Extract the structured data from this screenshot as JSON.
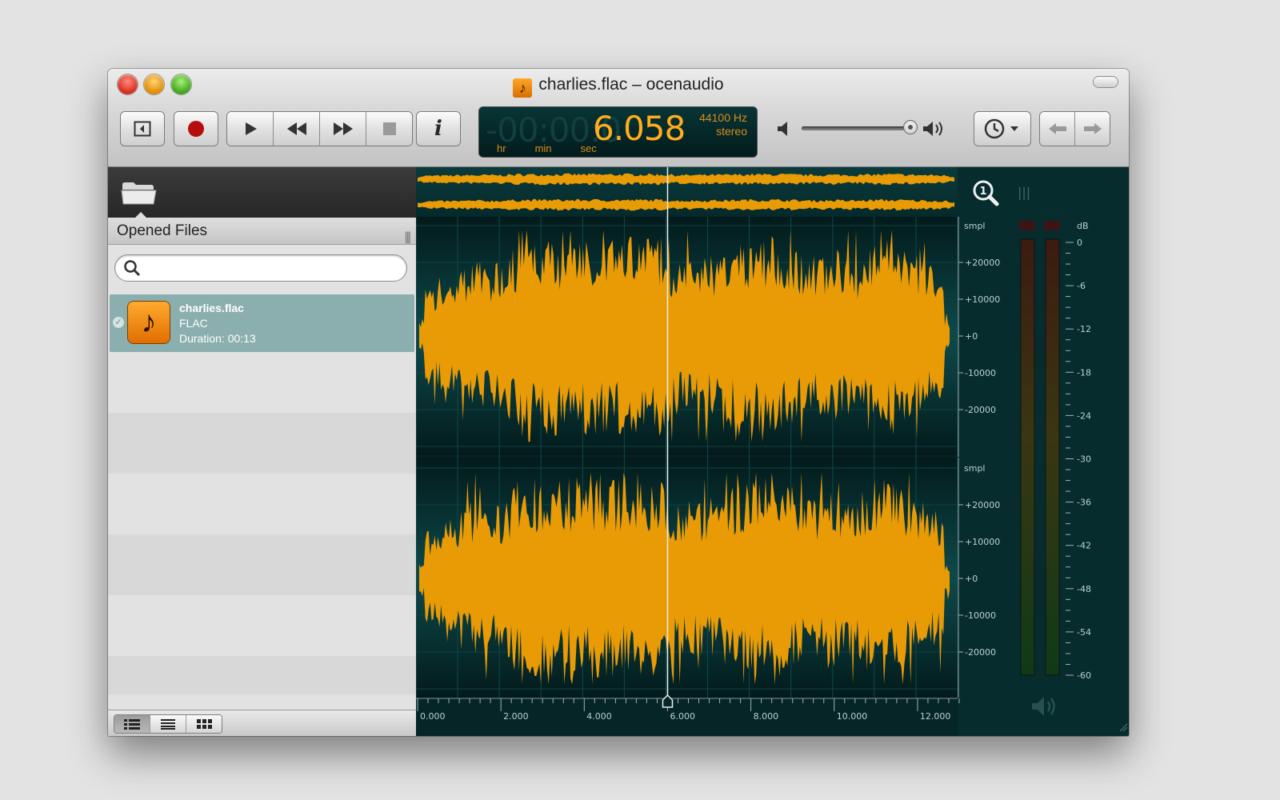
{
  "window": {
    "title": "charlies.flac – ocenaudio"
  },
  "transport": {
    "time_dim": "-00:00:0",
    "time_value": "6.058",
    "sample_rate": "44100 Hz",
    "channels": "stereo",
    "unit_hr": "hr",
    "unit_min": "min",
    "unit_sec": "sec",
    "volume_level": 0.92
  },
  "sidebar": {
    "header": "Opened Files",
    "search_placeholder": "",
    "files": [
      {
        "name": "charlies.flac",
        "format": "FLAC",
        "duration": "Duration: 00:13"
      }
    ]
  },
  "waveform": {
    "channel_unit": "smpl",
    "amplitude_labels": [
      "+20000",
      "+10000",
      "+0",
      "-10000",
      "-20000"
    ],
    "time_labels": [
      "0.000",
      "2.000",
      "4.000",
      "6.000",
      "8.000",
      "10.000",
      "12.000"
    ],
    "cursor_time": 6.058,
    "duration_seconds": 13,
    "waveform_color": "#e99b06",
    "background_color": "#052a2c"
  },
  "meter": {
    "unit": "dB",
    "labels": [
      "0",
      "-6",
      "-12",
      "-18",
      "-24",
      "-30",
      "-36",
      "-42",
      "-48",
      "-54",
      "-60"
    ]
  },
  "icons": {
    "zoom": "zoom-1-icon",
    "speaker": "speaker-icon",
    "folder": "folder-icon"
  }
}
